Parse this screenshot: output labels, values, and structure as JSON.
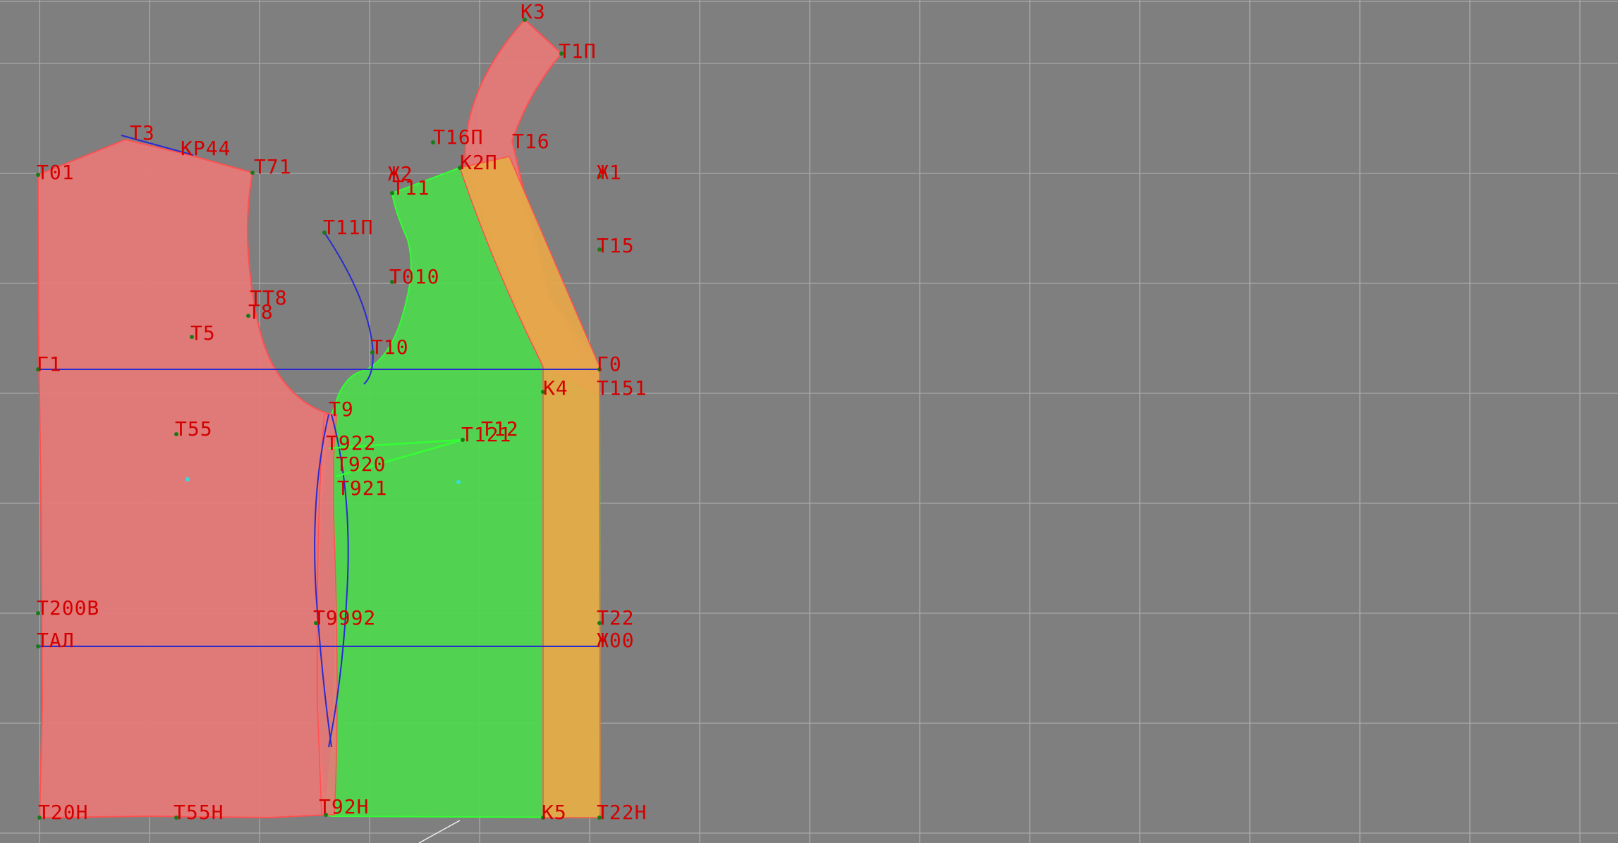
{
  "canvas": {
    "background": "#7f7f7f",
    "grid_color": "#a9a9a9"
  },
  "colors": {
    "back_piece_fill": "#e87a78",
    "back_piece_stroke": "#ff5050",
    "front_piece_fill": "#4fd84f",
    "front_piece_stroke": "#33ff33",
    "overlap_fill": "#e6a84a",
    "guide_line": "#2a2ad0",
    "label": "#d40000",
    "point": "#1a7a1a",
    "point_cyan": "#33dddd"
  },
  "labels": [
    {
      "id": "K3",
      "text": "K3"
    },
    {
      "id": "T1P",
      "text": "T1П"
    },
    {
      "id": "T3",
      "text": "T3"
    },
    {
      "id": "KP44",
      "text": "KP44"
    },
    {
      "id": "T01",
      "text": "T01"
    },
    {
      "id": "T71",
      "text": "T71"
    },
    {
      "id": "T16P",
      "text": "T16П"
    },
    {
      "id": "T16",
      "text": "T16"
    },
    {
      "id": "X2",
      "text": "Ж2"
    },
    {
      "id": "K2P",
      "text": "K2П"
    },
    {
      "id": "X1",
      "text": "Ж1"
    },
    {
      "id": "T11",
      "text": "T11"
    },
    {
      "id": "T11P",
      "text": "T11П"
    },
    {
      "id": "T15",
      "text": "T15"
    },
    {
      "id": "T010",
      "text": "T010"
    },
    {
      "id": "TT8",
      "text": "TT8"
    },
    {
      "id": "T8",
      "text": "T8"
    },
    {
      "id": "T5",
      "text": "T5"
    },
    {
      "id": "T10",
      "text": "T10"
    },
    {
      "id": "G1",
      "text": "Г1"
    },
    {
      "id": "G0",
      "text": "Г0"
    },
    {
      "id": "K4",
      "text": "K4"
    },
    {
      "id": "T151",
      "text": "T151"
    },
    {
      "id": "T9",
      "text": "T9"
    },
    {
      "id": "T55",
      "text": "T55"
    },
    {
      "id": "T922",
      "text": "T922"
    },
    {
      "id": "T12",
      "text": "T12"
    },
    {
      "id": "T121",
      "text": "T121"
    },
    {
      "id": "T920",
      "text": "T920"
    },
    {
      "id": "T921",
      "text": "T921"
    },
    {
      "id": "T200B",
      "text": "T200B"
    },
    {
      "id": "T992",
      "text": "T9992"
    },
    {
      "id": "T22",
      "text": "T22"
    },
    {
      "id": "TAL",
      "text": "TAЛ"
    },
    {
      "id": "X00",
      "text": "Ж00"
    },
    {
      "id": "T20H",
      "text": "T20H"
    },
    {
      "id": "T55H",
      "text": "T55H"
    },
    {
      "id": "T92H",
      "text": "T92H"
    },
    {
      "id": "K5",
      "text": "K5"
    },
    {
      "id": "T22H",
      "text": "T22H"
    }
  ]
}
